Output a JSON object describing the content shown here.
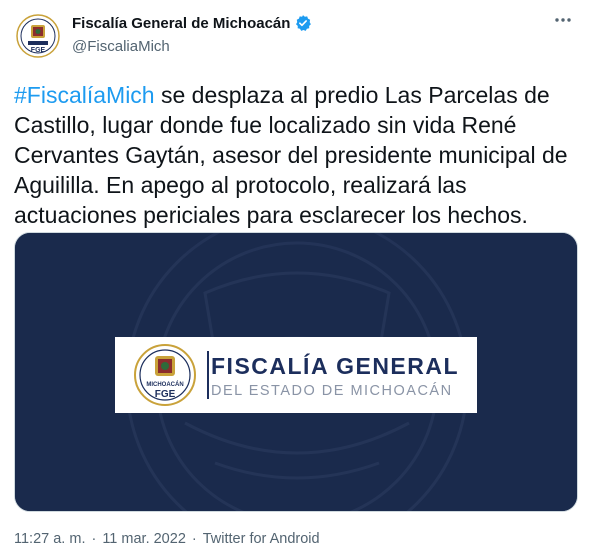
{
  "account": {
    "display_name": "Fiscalía General de Michoacán",
    "handle": "@FiscaliaMich",
    "verified": true,
    "avatar_icon": "fge-seal-icon",
    "avatar_label": "FGE"
  },
  "tweet": {
    "hashtag": "#FiscalíaMich",
    "text": " se desplaza al predio Las Parcelas de Castillo, lugar donde fue localizado sin vida René Cervantes Gaytán, asesor del presidente municipal de Aguililla. En apego al protocolo, realizará las actuaciones periciales para esclarecer los hechos."
  },
  "media": {
    "seal_text": "MICHOACÁN",
    "seal_label": "FGE",
    "title": "FISCALÍA GENERAL",
    "subtitle": "DEL ESTADO DE MICHOACÁN",
    "background_color": "#1a2a4c"
  },
  "meta": {
    "time": "11:27 a. m.",
    "date": "11 mar. 2022",
    "separator": "·",
    "source": "Twitter for Android"
  },
  "colors": {
    "link": "#1d9bf0",
    "secondary_text": "#536471",
    "brand_navy": "#1c2e5c",
    "verified": "#1d9bf0"
  }
}
